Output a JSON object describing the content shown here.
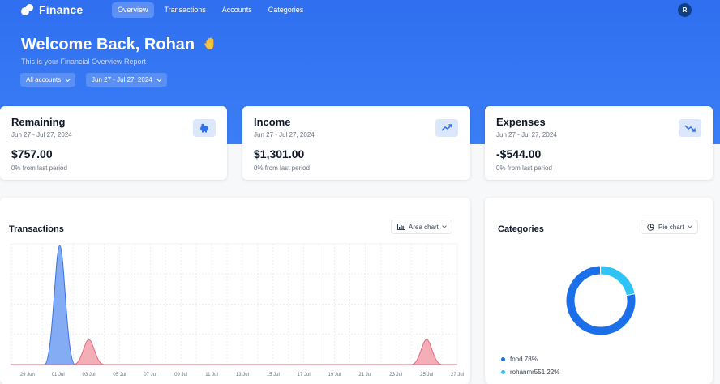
{
  "app": {
    "name": "Finance",
    "avatar_initial": "R"
  },
  "nav": {
    "items": [
      {
        "label": "Overview",
        "active": true
      },
      {
        "label": "Transactions",
        "active": false
      },
      {
        "label": "Accounts",
        "active": false
      },
      {
        "label": "Categories",
        "active": false
      }
    ]
  },
  "hero": {
    "welcome": "Welcome Back, Rohan",
    "subtitle": "This is your Financial Overview Report",
    "account_filter": "All accounts",
    "date_filter": "Jun 27 - Jul 27, 2024"
  },
  "stats": [
    {
      "title": "Remaining",
      "range": "Jun 27 - Jul 27, 2024",
      "value": "$757.00",
      "change": "0% from last period",
      "icon": "piggy-bank-icon"
    },
    {
      "title": "Income",
      "range": "Jun 27 - Jul 27, 2024",
      "value": "$1,301.00",
      "change": "0% from last period",
      "icon": "trending-up-icon"
    },
    {
      "title": "Expenses",
      "range": "Jun 27 - Jul 27, 2024",
      "value": "-$544.00",
      "change": "0% from last period",
      "icon": "trending-down-icon"
    }
  ],
  "transactions": {
    "title": "Transactions",
    "chart_type_label": "Area chart",
    "chart_data": {
      "type": "area",
      "x": [
        "29 Jun",
        "01 Jul",
        "03 Jul",
        "05 Jul",
        "07 Jul",
        "09 Jul",
        "11 Jul",
        "13 Jul",
        "15 Jul",
        "17 Jul",
        "19 Jul",
        "21 Jul",
        "23 Jul",
        "25 Jul",
        "27 Jul"
      ],
      "series": [
        {
          "values": [
            0,
            1301,
            0,
            0,
            0,
            0,
            0,
            0,
            0,
            0,
            0,
            0,
            0,
            0,
            0
          ],
          "color": "#6f9df2"
        },
        {
          "values": [
            0,
            0,
            272,
            0,
            0,
            0,
            0,
            0,
            0,
            0,
            0,
            0,
            0,
            272,
            0
          ],
          "color": "#f2a0ac"
        }
      ],
      "ylim": [
        0,
        1301
      ],
      "grid": true
    }
  },
  "categories": {
    "title": "Categories",
    "chart_type_label": "Pie chart",
    "chart_data": {
      "type": "pie",
      "donut": true,
      "labels": [
        "food",
        "rohanmr551"
      ],
      "values": [
        78,
        22
      ],
      "colors": [
        "#1b6fe8",
        "#2fc3f5"
      ],
      "legend": [
        {
          "label": "food 78%",
          "color": "#1b6fe8"
        },
        {
          "label": "rohanmr551 22%",
          "color": "#2fc3f5"
        }
      ]
    }
  }
}
